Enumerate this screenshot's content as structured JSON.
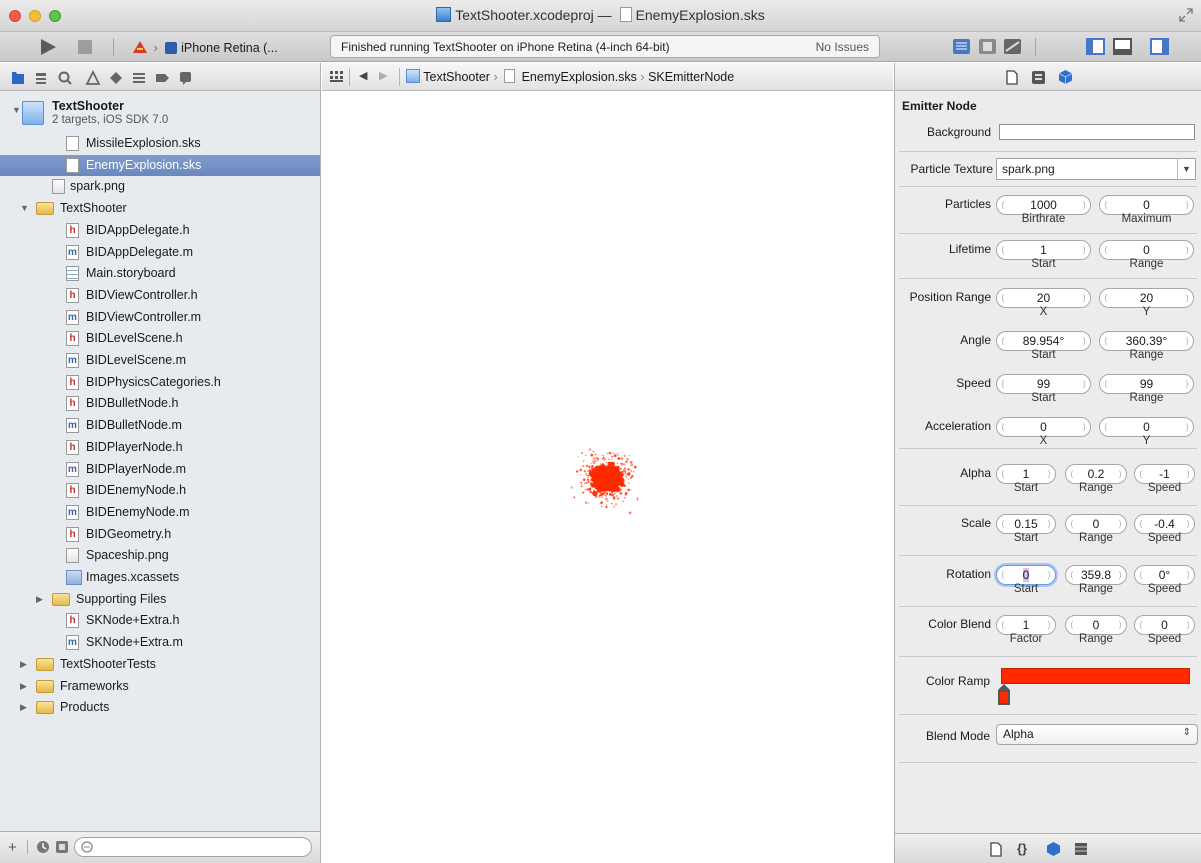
{
  "window": {
    "project_title": "TextShooter.xcodeproj",
    "title_sep": "—",
    "file_title": "EnemyExplosion.sks"
  },
  "toolbar": {
    "scheme_target": "iPhone Retina (...",
    "status_text": "Finished running TextShooter on iPhone Retina (4-inch 64-bit)",
    "issues_text": "No Issues"
  },
  "navigator": {
    "project_name": "TextShooter",
    "project_subtitle": "2 targets, iOS SDK 7.0",
    "items": [
      {
        "label": "MissileExplosion.sks"
      },
      {
        "label": "EnemyExplosion.sks"
      },
      {
        "label": "spark.png"
      },
      {
        "label": "TextShooter"
      },
      {
        "label": "BIDAppDelegate.h",
        "badge": "h"
      },
      {
        "label": "BIDAppDelegate.m",
        "badge": "m"
      },
      {
        "label": "Main.storyboard"
      },
      {
        "label": "BIDViewController.h",
        "badge": "h"
      },
      {
        "label": "BIDViewController.m",
        "badge": "m"
      },
      {
        "label": "BIDLevelScene.h",
        "badge": "h"
      },
      {
        "label": "BIDLevelScene.m",
        "badge": "m"
      },
      {
        "label": "BIDPhysicsCategories.h",
        "badge": "h"
      },
      {
        "label": "BIDBulletNode.h",
        "badge": "h"
      },
      {
        "label": "BIDBulletNode.m",
        "badge": "m"
      },
      {
        "label": "BIDPlayerNode.h",
        "badge": "h"
      },
      {
        "label": "BIDPlayerNode.m",
        "badge": "m"
      },
      {
        "label": "BIDEnemyNode.h",
        "badge": "h"
      },
      {
        "label": "BIDEnemyNode.m",
        "badge": "m"
      },
      {
        "label": "BIDGeometry.h",
        "badge": "h"
      },
      {
        "label": "Spaceship.png"
      },
      {
        "label": "Images.xcassets"
      },
      {
        "label": "Supporting Files"
      },
      {
        "label": "SKNode+Extra.h",
        "badge": "h"
      },
      {
        "label": "SKNode+Extra.m",
        "badge": "m"
      },
      {
        "label": "TextShooterTests"
      },
      {
        "label": "Frameworks"
      },
      {
        "label": "Products"
      }
    ],
    "selected_index": 1
  },
  "jumpbar": {
    "crumb_project": "TextShooter",
    "crumb_file": "EnemyExplosion.sks",
    "crumb_node": "SKEmitterNode"
  },
  "inspector": {
    "section_title": "Emitter Node",
    "background_label": "Background",
    "particle_texture_label": "Particle Texture",
    "particle_texture_value": "spark.png",
    "particles": {
      "label": "Particles",
      "birthrate": "1000",
      "maximum": "0",
      "sub1": "Birthrate",
      "sub2": "Maximum"
    },
    "lifetime": {
      "label": "Lifetime",
      "start": "1",
      "range": "0",
      "sub1": "Start",
      "sub2": "Range"
    },
    "position_range": {
      "label": "Position Range",
      "x": "20",
      "y": "20",
      "sub1": "X",
      "sub2": "Y"
    },
    "angle": {
      "label": "Angle",
      "start": "89.954°",
      "range": "360.39°",
      "sub1": "Start",
      "sub2": "Range"
    },
    "speed": {
      "label": "Speed",
      "start": "99",
      "range": "99",
      "sub1": "Start",
      "sub2": "Range"
    },
    "acceleration": {
      "label": "Acceleration",
      "x": "0",
      "y": "0",
      "sub1": "X",
      "sub2": "Y"
    },
    "alpha": {
      "label": "Alpha",
      "start": "1",
      "range": "0.2",
      "speed": "-1",
      "sub1": "Start",
      "sub2": "Range",
      "sub3": "Speed"
    },
    "scale": {
      "label": "Scale",
      "start": "0.15",
      "range": "0",
      "speed": "-0.4",
      "sub1": "Start",
      "sub2": "Range",
      "sub3": "Speed"
    },
    "rotation": {
      "label": "Rotation",
      "start": "0",
      "range": "359.8",
      "speed": "0°",
      "sub1": "Start",
      "sub2": "Range",
      "sub3": "Speed"
    },
    "color_blend": {
      "label": "Color Blend",
      "factor": "1",
      "range": "0",
      "speed": "0",
      "sub1": "Factor",
      "sub2": "Range",
      "sub3": "Speed"
    },
    "color_ramp_label": "Color Ramp",
    "color_ramp_color": "#ff2a00",
    "blend_mode_label": "Blend Mode",
    "blend_mode_value": "Alpha"
  },
  "colors": {
    "particle": "#ff2a00",
    "selection": "#7390c4"
  }
}
